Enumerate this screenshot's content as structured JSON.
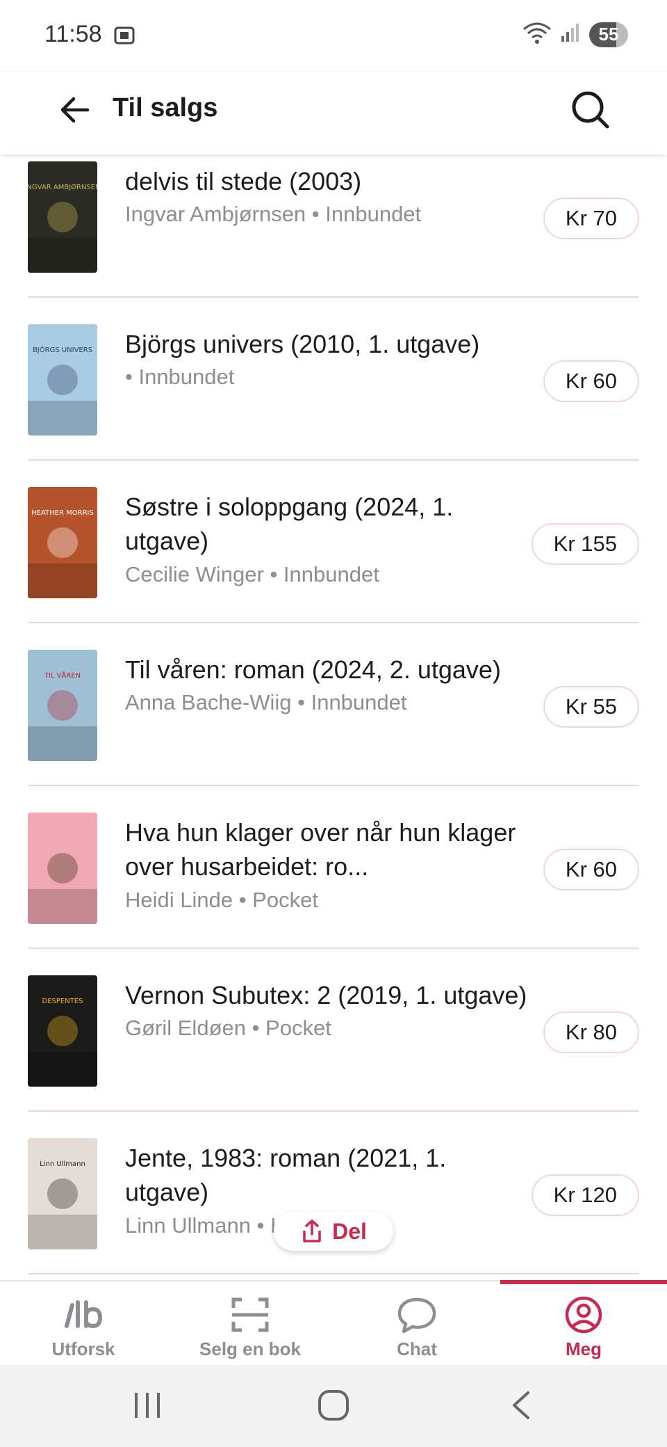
{
  "status": {
    "time": "11:58",
    "battery": "55"
  },
  "header": {
    "title": "Til salgs"
  },
  "items": [
    {
      "title": "delvis til stede (2003)",
      "meta": "Ingvar Ambjørnsen • Innbundet",
      "price": "Kr 70",
      "cover_bg": "#2a2b22",
      "cover_fg": "#c9b45a",
      "cover_text": "INGVAR AMBJØRNSEN"
    },
    {
      "title": "Björgs univers (2010, 1. utgave)",
      "meta": " • Innbundet",
      "price": "Kr 60",
      "cover_bg": "#a9cbe3",
      "cover_fg": "#334466",
      "cover_text": "BJÖRGS UNIVERS"
    },
    {
      "title": "Søstre i soloppgang (2024, 1. utgave)",
      "meta": "Cecilie Winger • Innbundet",
      "price": "Kr 155",
      "cover_bg": "#b5542c",
      "cover_fg": "#ffffff",
      "cover_text": "HEATHER MORRIS"
    },
    {
      "title": "Til våren: roman (2024, 2. utgave)",
      "meta": "Anna Bache-Wiig • Innbundet",
      "price": "Kr 55",
      "cover_bg": "#9fc0d4",
      "cover_fg": "#b8242c",
      "cover_text": "TIL VÅREN"
    },
    {
      "title": "Hva hun klager over når hun klager over husarbeidet: ro...",
      "meta": "Heidi Linde • Pocket",
      "price": "Kr 60",
      "cover_bg": "#f0a8b4",
      "cover_fg": "#3a2a10",
      "cover_text": ""
    },
    {
      "title": "Vernon Subutex: 2 (2019, 1. utgave)",
      "meta": "Gøril Eldøen • Pocket",
      "price": "Kr 80",
      "cover_bg": "#1a1a1a",
      "cover_fg": "#f3b51c",
      "cover_text": "DESPENTES"
    },
    {
      "title": "Jente, 1983: roman (2021, 1. utgave)",
      "meta": "Linn Ullmann • Innbundet",
      "price": "Kr 120",
      "cover_bg": "#e4dcd6",
      "cover_fg": "#222222",
      "cover_text": "Linn Ullmann"
    },
    {
      "title": "",
      "meta": "",
      "price": "",
      "cover_bg": "#222222",
      "cover_fg": "#ffffff",
      "cover_text": ""
    }
  ],
  "share": {
    "label": "Del"
  },
  "nav": [
    {
      "label": "Utforsk",
      "icon": "utforsk-logo-icon"
    },
    {
      "label": "Selg en bok",
      "icon": "scan-icon"
    },
    {
      "label": "Chat",
      "icon": "chat-bubble-icon"
    },
    {
      "label": "Meg",
      "icon": "profile-icon"
    }
  ],
  "colors": {
    "accent": "#c8294f",
    "divider": "#f2d6de",
    "muted": "#8d8d92"
  }
}
